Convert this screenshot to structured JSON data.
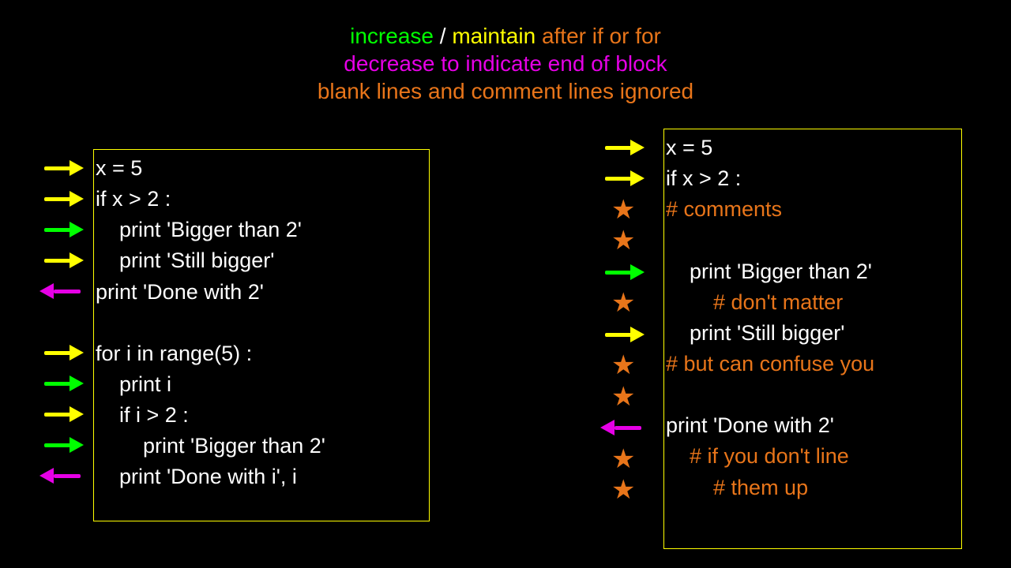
{
  "header": {
    "line1": {
      "increase": "increase",
      "slash": "/",
      "maintain": "maintain",
      "rest": "after if or for"
    },
    "line2": "decrease to indicate end of block",
    "line3": "blank lines and comment lines ignored"
  },
  "left_box": {
    "lines": [
      "x = 5",
      "if x > 2 :",
      "    print 'Bigger than 2'",
      "    print 'Still bigger'",
      "print 'Done with 2'",
      "",
      "for i in range(5) :",
      "    print i",
      "    if i > 2 :",
      "        print 'Bigger than 2'",
      "    print 'Done with i', i"
    ],
    "markers": [
      {
        "type": "arrow",
        "dir": "right",
        "color": "yellow"
      },
      {
        "type": "arrow",
        "dir": "right",
        "color": "yellow"
      },
      {
        "type": "arrow",
        "dir": "right",
        "color": "green"
      },
      {
        "type": "arrow",
        "dir": "right",
        "color": "yellow"
      },
      {
        "type": "arrow",
        "dir": "left",
        "color": "magenta"
      },
      {
        "type": "blank"
      },
      {
        "type": "arrow",
        "dir": "right",
        "color": "yellow"
      },
      {
        "type": "arrow",
        "dir": "right",
        "color": "green"
      },
      {
        "type": "arrow",
        "dir": "right",
        "color": "yellow"
      },
      {
        "type": "arrow",
        "dir": "right",
        "color": "green"
      },
      {
        "type": "arrow",
        "dir": "left",
        "color": "magenta"
      }
    ]
  },
  "right_box": {
    "lines": [
      {
        "text": "x = 5",
        "orange": false
      },
      {
        "text": "if x > 2 :",
        "orange": false
      },
      {
        "text": "# comments",
        "orange": true
      },
      {
        "text": "",
        "orange": false
      },
      {
        "text": "    print 'Bigger than 2'",
        "orange": false
      },
      {
        "text": "        # don't matter",
        "orange": true
      },
      {
        "text": "    print 'Still bigger'",
        "orange": false
      },
      {
        "text": "# but can confuse you",
        "orange": true
      },
      {
        "text": "",
        "orange": false
      },
      {
        "text": "print 'Done with 2'",
        "orange": false
      },
      {
        "text": "    # if you don't line",
        "orange": true
      },
      {
        "text": "        # them up",
        "orange": true
      }
    ],
    "markers": [
      {
        "type": "arrow",
        "dir": "right",
        "color": "yellow"
      },
      {
        "type": "arrow",
        "dir": "right",
        "color": "yellow"
      },
      {
        "type": "star"
      },
      {
        "type": "star"
      },
      {
        "type": "arrow",
        "dir": "right",
        "color": "green"
      },
      {
        "type": "star"
      },
      {
        "type": "arrow",
        "dir": "right",
        "color": "yellow"
      },
      {
        "type": "star"
      },
      {
        "type": "star"
      },
      {
        "type": "arrow",
        "dir": "left",
        "color": "magenta"
      },
      {
        "type": "star"
      },
      {
        "type": "star"
      }
    ]
  }
}
